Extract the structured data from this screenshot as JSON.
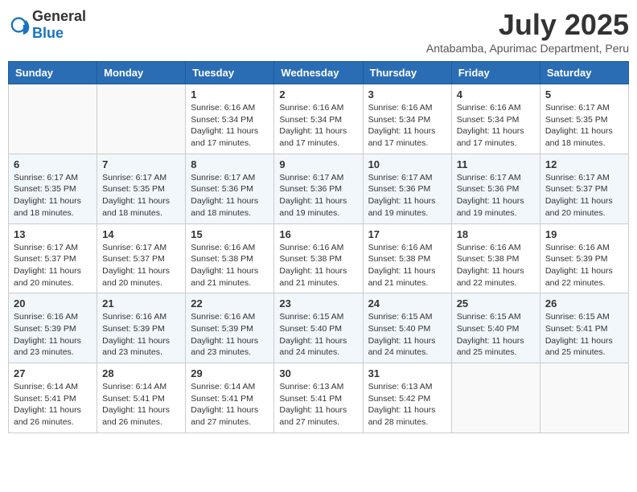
{
  "header": {
    "logo_general": "General",
    "logo_blue": "Blue",
    "month_year": "July 2025",
    "location": "Antabamba, Apurimac Department, Peru"
  },
  "weekdays": [
    "Sunday",
    "Monday",
    "Tuesday",
    "Wednesday",
    "Thursday",
    "Friday",
    "Saturday"
  ],
  "weeks": [
    [
      {
        "day": "",
        "text": ""
      },
      {
        "day": "",
        "text": ""
      },
      {
        "day": "1",
        "text": "Sunrise: 6:16 AM\nSunset: 5:34 PM\nDaylight: 11 hours and 17 minutes."
      },
      {
        "day": "2",
        "text": "Sunrise: 6:16 AM\nSunset: 5:34 PM\nDaylight: 11 hours and 17 minutes."
      },
      {
        "day": "3",
        "text": "Sunrise: 6:16 AM\nSunset: 5:34 PM\nDaylight: 11 hours and 17 minutes."
      },
      {
        "day": "4",
        "text": "Sunrise: 6:16 AM\nSunset: 5:34 PM\nDaylight: 11 hours and 17 minutes."
      },
      {
        "day": "5",
        "text": "Sunrise: 6:17 AM\nSunset: 5:35 PM\nDaylight: 11 hours and 18 minutes."
      }
    ],
    [
      {
        "day": "6",
        "text": "Sunrise: 6:17 AM\nSunset: 5:35 PM\nDaylight: 11 hours and 18 minutes."
      },
      {
        "day": "7",
        "text": "Sunrise: 6:17 AM\nSunset: 5:35 PM\nDaylight: 11 hours and 18 minutes."
      },
      {
        "day": "8",
        "text": "Sunrise: 6:17 AM\nSunset: 5:36 PM\nDaylight: 11 hours and 18 minutes."
      },
      {
        "day": "9",
        "text": "Sunrise: 6:17 AM\nSunset: 5:36 PM\nDaylight: 11 hours and 19 minutes."
      },
      {
        "day": "10",
        "text": "Sunrise: 6:17 AM\nSunset: 5:36 PM\nDaylight: 11 hours and 19 minutes."
      },
      {
        "day": "11",
        "text": "Sunrise: 6:17 AM\nSunset: 5:36 PM\nDaylight: 11 hours and 19 minutes."
      },
      {
        "day": "12",
        "text": "Sunrise: 6:17 AM\nSunset: 5:37 PM\nDaylight: 11 hours and 20 minutes."
      }
    ],
    [
      {
        "day": "13",
        "text": "Sunrise: 6:17 AM\nSunset: 5:37 PM\nDaylight: 11 hours and 20 minutes."
      },
      {
        "day": "14",
        "text": "Sunrise: 6:17 AM\nSunset: 5:37 PM\nDaylight: 11 hours and 20 minutes."
      },
      {
        "day": "15",
        "text": "Sunrise: 6:16 AM\nSunset: 5:38 PM\nDaylight: 11 hours and 21 minutes."
      },
      {
        "day": "16",
        "text": "Sunrise: 6:16 AM\nSunset: 5:38 PM\nDaylight: 11 hours and 21 minutes."
      },
      {
        "day": "17",
        "text": "Sunrise: 6:16 AM\nSunset: 5:38 PM\nDaylight: 11 hours and 21 minutes."
      },
      {
        "day": "18",
        "text": "Sunrise: 6:16 AM\nSunset: 5:38 PM\nDaylight: 11 hours and 22 minutes."
      },
      {
        "day": "19",
        "text": "Sunrise: 6:16 AM\nSunset: 5:39 PM\nDaylight: 11 hours and 22 minutes."
      }
    ],
    [
      {
        "day": "20",
        "text": "Sunrise: 6:16 AM\nSunset: 5:39 PM\nDaylight: 11 hours and 23 minutes."
      },
      {
        "day": "21",
        "text": "Sunrise: 6:16 AM\nSunset: 5:39 PM\nDaylight: 11 hours and 23 minutes."
      },
      {
        "day": "22",
        "text": "Sunrise: 6:16 AM\nSunset: 5:39 PM\nDaylight: 11 hours and 23 minutes."
      },
      {
        "day": "23",
        "text": "Sunrise: 6:15 AM\nSunset: 5:40 PM\nDaylight: 11 hours and 24 minutes."
      },
      {
        "day": "24",
        "text": "Sunrise: 6:15 AM\nSunset: 5:40 PM\nDaylight: 11 hours and 24 minutes."
      },
      {
        "day": "25",
        "text": "Sunrise: 6:15 AM\nSunset: 5:40 PM\nDaylight: 11 hours and 25 minutes."
      },
      {
        "day": "26",
        "text": "Sunrise: 6:15 AM\nSunset: 5:41 PM\nDaylight: 11 hours and 25 minutes."
      }
    ],
    [
      {
        "day": "27",
        "text": "Sunrise: 6:14 AM\nSunset: 5:41 PM\nDaylight: 11 hours and 26 minutes."
      },
      {
        "day": "28",
        "text": "Sunrise: 6:14 AM\nSunset: 5:41 PM\nDaylight: 11 hours and 26 minutes."
      },
      {
        "day": "29",
        "text": "Sunrise: 6:14 AM\nSunset: 5:41 PM\nDaylight: 11 hours and 27 minutes."
      },
      {
        "day": "30",
        "text": "Sunrise: 6:13 AM\nSunset: 5:41 PM\nDaylight: 11 hours and 27 minutes."
      },
      {
        "day": "31",
        "text": "Sunrise: 6:13 AM\nSunset: 5:42 PM\nDaylight: 11 hours and 28 minutes."
      },
      {
        "day": "",
        "text": ""
      },
      {
        "day": "",
        "text": ""
      }
    ]
  ]
}
